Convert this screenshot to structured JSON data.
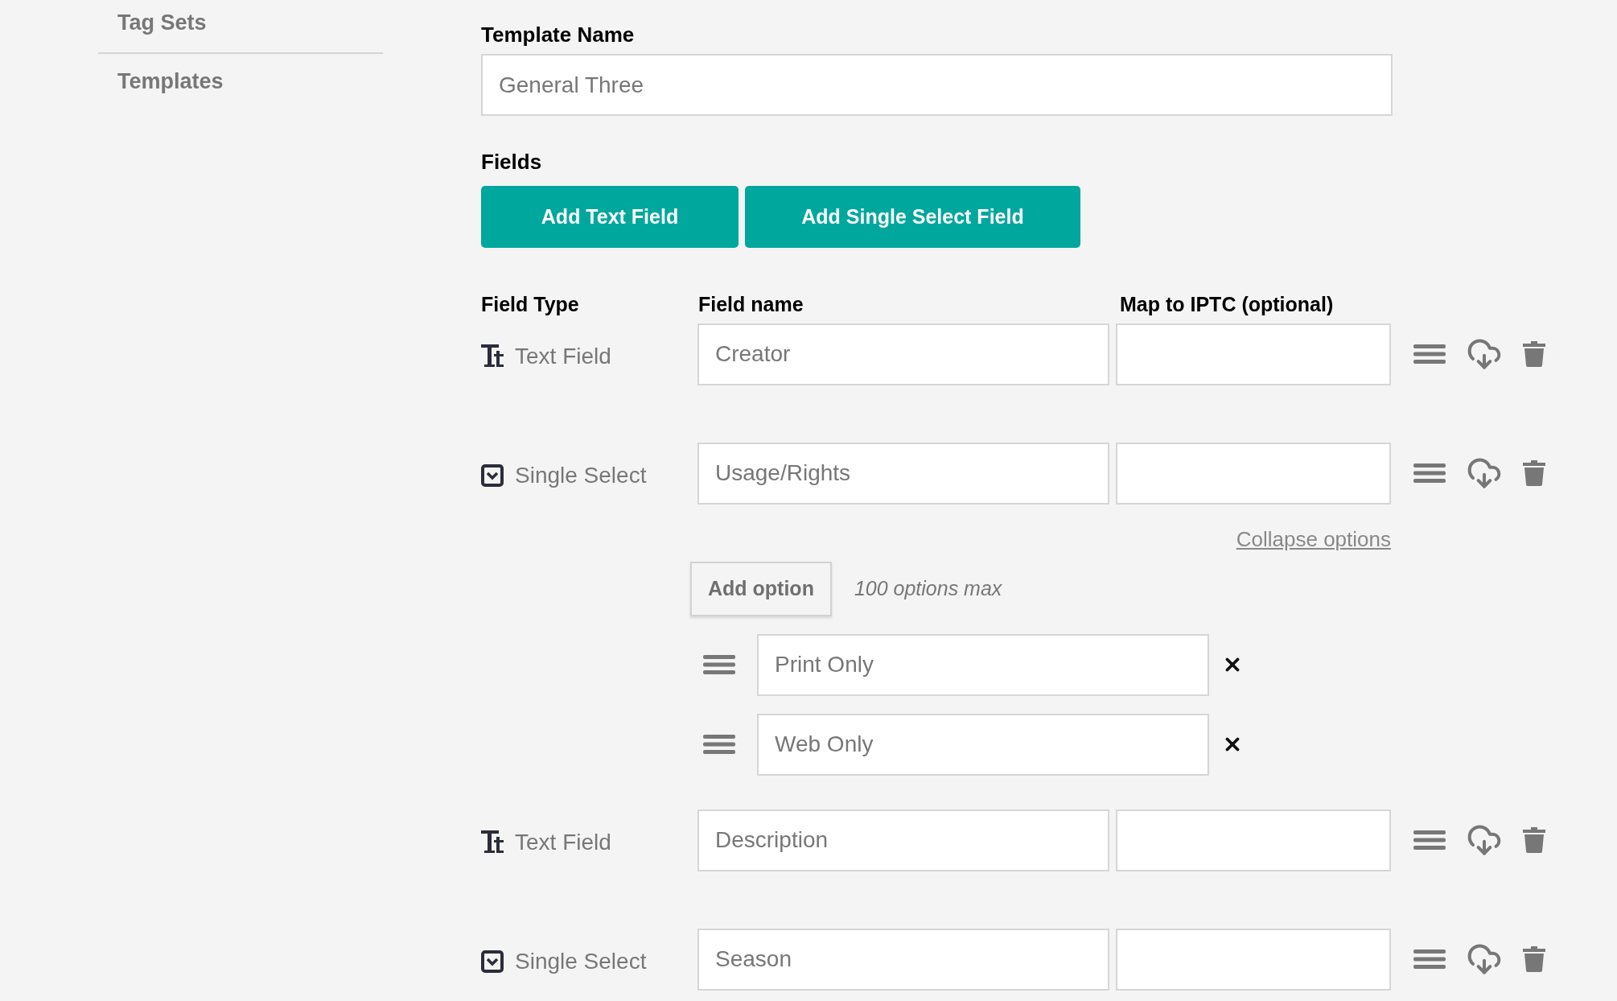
{
  "sidebar": {
    "items": [
      {
        "label": "Tag Sets"
      },
      {
        "label": "Templates"
      }
    ]
  },
  "template_name": {
    "label": "Template Name",
    "value": "General Three"
  },
  "fields_section": {
    "label": "Fields",
    "buttons": [
      "Add Text Field",
      "Add Single Select Field"
    ]
  },
  "columns": [
    "Field Type",
    "Field name",
    "Map to IPTC (optional)"
  ],
  "fields": [
    {
      "kind": "text",
      "type_label": "Text Field",
      "name": "Creator",
      "expanded": false
    },
    {
      "kind": "select",
      "type_label": "Single Select",
      "name": "Usage/Rights",
      "expanded": true,
      "collapse_link": "Collapse options",
      "add_option": "Add option",
      "max_note": "100 options max",
      "options": [
        "Print Only",
        "Web Only"
      ]
    },
    {
      "kind": "text",
      "type_label": "Text Field",
      "name": "Description",
      "expanded": false
    },
    {
      "kind": "select",
      "type_label": "Single Select",
      "name": "Season",
      "expanded": false
    }
  ]
}
